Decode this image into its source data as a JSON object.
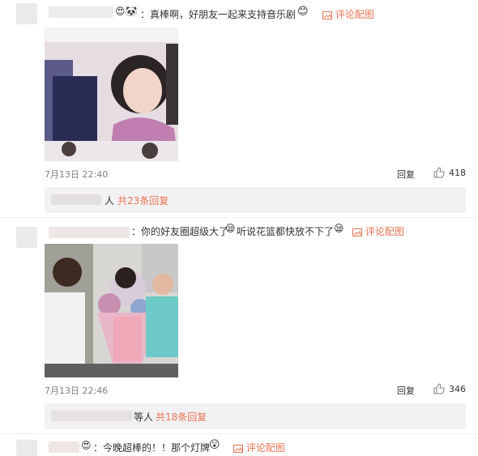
{
  "comments": [
    {
      "text": "：真棒啊，好朋友一起来支持音乐剧",
      "picture_link": "评论配图",
      "time": "7月13日 22:40",
      "reply_label": "回复",
      "likes": "418",
      "replies_text": "共23条回复",
      "replies_prefix": "人"
    },
    {
      "text": "：你的好友圈超级大了",
      "text2": "听说花篮都快放不下了",
      "picture_link": "评论配图",
      "time": "7月13日 22:46",
      "reply_label": "回复",
      "likes": "346",
      "replies_text": "共18条回复",
      "replies_prefix": "等人"
    },
    {
      "text": "：今晚超棒的！！那个灯牌",
      "picture_link": "评论配图"
    }
  ],
  "colors": {
    "link": "#eb7350",
    "muted": "#808080",
    "reply_bar": "#f2f2f5"
  }
}
